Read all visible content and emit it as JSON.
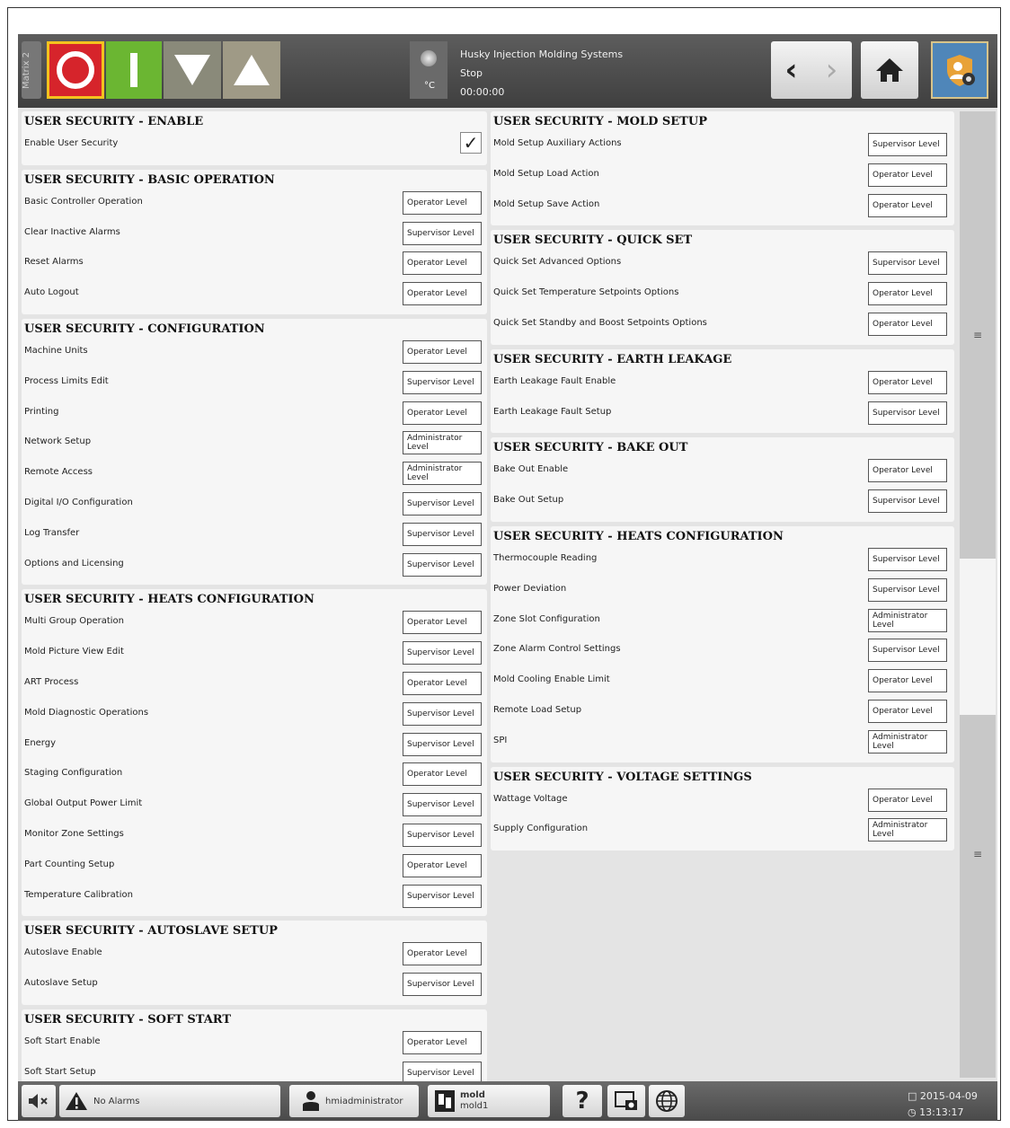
{
  "header": {
    "matrix_tab": "Matrix 2",
    "temp_unit": "°C",
    "system_name": "Husky Injection Molding Systems",
    "state": "Stop",
    "timer": "00:00:00"
  },
  "left": {
    "sections": [
      {
        "title": "USER SECURITY - ENABLE",
        "rows": [
          {
            "label": "Enable User Security",
            "check": "✓"
          }
        ]
      },
      {
        "title": "USER SECURITY - BASIC OPERATION",
        "rows": [
          {
            "label": "Basic Controller Operation",
            "level": "Operator Level"
          },
          {
            "label": "Clear Inactive Alarms",
            "level": "Supervisor Level"
          },
          {
            "label": "Reset Alarms",
            "level": "Operator Level"
          },
          {
            "label": "Auto Logout",
            "level": "Operator Level"
          }
        ]
      },
      {
        "title": "USER SECURITY - CONFIGURATION",
        "rows": [
          {
            "label": "Machine Units",
            "level": "Operator Level"
          },
          {
            "label": "Process Limits Edit",
            "level": "Supervisor Level"
          },
          {
            "label": "Printing",
            "level": "Operator Level"
          },
          {
            "label": "Network Setup",
            "level": "Administrator Level"
          },
          {
            "label": "Remote Access",
            "level": "Administrator Level"
          },
          {
            "label": "Digital I/O Configuration",
            "level": "Supervisor Level"
          },
          {
            "label": "Log Transfer",
            "level": "Supervisor Level"
          },
          {
            "label": "Options and Licensing",
            "level": "Supervisor Level"
          }
        ]
      },
      {
        "title": "USER SECURITY - HEATS CONFIGURATION",
        "rows": [
          {
            "label": "Multi Group Operation",
            "level": "Operator Level"
          },
          {
            "label": "Mold Picture View Edit",
            "level": "Supervisor Level"
          },
          {
            "label": "ART Process",
            "level": "Operator Level"
          },
          {
            "label": "Mold Diagnostic Operations",
            "level": "Supervisor Level"
          },
          {
            "label": "Energy",
            "level": "Supervisor Level"
          },
          {
            "label": "Staging Configuration",
            "level": "Operator Level"
          },
          {
            "label": "Global Output Power Limit",
            "level": "Supervisor Level"
          },
          {
            "label": "Monitor Zone Settings",
            "level": "Supervisor Level"
          },
          {
            "label": "Part Counting Setup",
            "level": "Operator Level"
          },
          {
            "label": "Temperature Calibration",
            "level": "Supervisor Level"
          }
        ]
      },
      {
        "title": "USER SECURITY - AUTOSLAVE SETUP",
        "rows": [
          {
            "label": "Autoslave Enable",
            "level": "Operator Level"
          },
          {
            "label": "Autoslave Setup",
            "level": "Supervisor Level"
          }
        ]
      },
      {
        "title": "USER SECURITY - SOFT START",
        "rows": [
          {
            "label": "Soft Start Enable",
            "level": "Operator Level"
          },
          {
            "label": "Soft Start Setup",
            "level": "Supervisor Level"
          }
        ]
      }
    ]
  },
  "right": {
    "sections": [
      {
        "title": "USER SECURITY - MOLD SETUP",
        "rows": [
          {
            "label": "Mold Setup Auxiliary Actions",
            "level": "Supervisor Level"
          },
          {
            "label": "Mold Setup Load Action",
            "level": "Operator Level"
          },
          {
            "label": "Mold Setup Save Action",
            "level": "Operator Level"
          }
        ]
      },
      {
        "title": "USER SECURITY - QUICK SET",
        "rows": [
          {
            "label": "Quick Set Advanced Options",
            "level": "Supervisor Level"
          },
          {
            "label": "Quick Set Temperature Setpoints Options",
            "level": "Operator Level"
          },
          {
            "label": "Quick Set Standby and Boost Setpoints Options",
            "level": "Operator Level"
          }
        ]
      },
      {
        "title": "USER SECURITY - EARTH LEAKAGE",
        "rows": [
          {
            "label": "Earth Leakage Fault Enable",
            "level": "Operator Level"
          },
          {
            "label": "Earth Leakage Fault Setup",
            "level": "Supervisor Level"
          }
        ]
      },
      {
        "title": "USER SECURITY - BAKE OUT",
        "rows": [
          {
            "label": "Bake Out Enable",
            "level": "Operator Level"
          },
          {
            "label": "Bake Out Setup",
            "level": "Supervisor Level"
          }
        ]
      },
      {
        "title": "USER SECURITY - HEATS CONFIGURATION",
        "rows": [
          {
            "label": "Thermocouple Reading",
            "level": "Supervisor Level"
          },
          {
            "label": "Power Deviation",
            "level": "Supervisor Level"
          },
          {
            "label": "Zone Slot Configuration",
            "level": "Administrator Level"
          },
          {
            "label": "Zone Alarm Control Settings",
            "level": "Supervisor Level"
          },
          {
            "label": "Mold Cooling Enable Limit",
            "level": "Operator Level"
          },
          {
            "label": "Remote Load Setup",
            "level": "Operator Level"
          },
          {
            "label": "SPI",
            "level": "Administrator Level"
          }
        ]
      },
      {
        "title": "USER SECURITY - VOLTAGE SETTINGS",
        "rows": [
          {
            "label": "Wattage Voltage",
            "level": "Operator Level"
          },
          {
            "label": "Supply Configuration",
            "level": "Administrator Level"
          }
        ]
      }
    ]
  },
  "footer": {
    "alarms": "No Alarms",
    "user": "hmiadministrator",
    "mold_title": "mold",
    "mold_name": "mold1",
    "help_glyph": "?",
    "date": "2015-04-09",
    "time": "13:13:17"
  },
  "colors": {
    "stop": "#d6242b",
    "on": "#6bb632",
    "security": "#4f86b9",
    "accent_border": "#f4c21e"
  }
}
